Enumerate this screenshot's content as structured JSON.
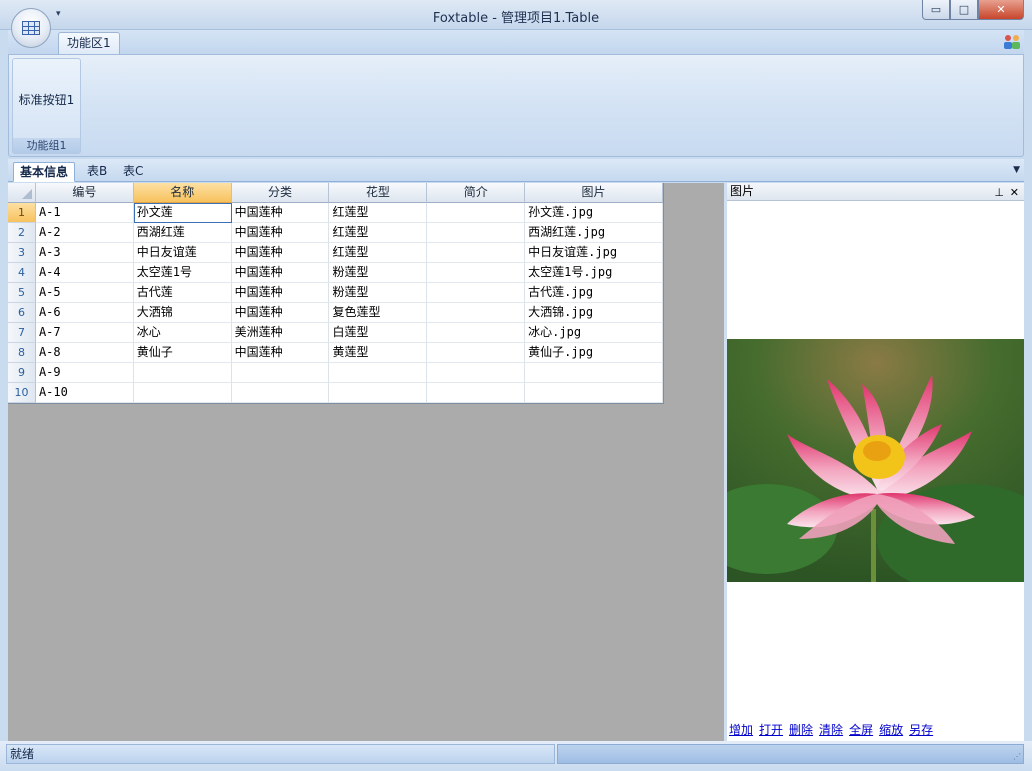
{
  "window": {
    "title": "Foxtable - 管理项目1.Table",
    "min_glyph": "▭",
    "max_glyph": "□",
    "close_glyph": "✕",
    "qat_glyph": "▾"
  },
  "ribbon": {
    "tab_label": "功能区1",
    "group_label": "功能组1",
    "button_label": "标准按钮1"
  },
  "doc_tabs": [
    "基本信息",
    "表B",
    "表C"
  ],
  "doc_tab_arrow": "▼",
  "table": {
    "columns": [
      "编号",
      "名称",
      "分类",
      "花型",
      "简介",
      "图片"
    ],
    "rows": [
      [
        "1",
        "A-1",
        "孙文莲",
        "中国莲种",
        "红莲型",
        "",
        "孙文莲.jpg"
      ],
      [
        "2",
        "A-2",
        "西湖红莲",
        "中国莲种",
        "红莲型",
        "",
        "西湖红莲.jpg"
      ],
      [
        "3",
        "A-3",
        "中日友谊莲",
        "中国莲种",
        "红莲型",
        "",
        "中日友谊莲.jpg"
      ],
      [
        "4",
        "A-4",
        "太空莲1号",
        "中国莲种",
        "粉莲型",
        "",
        "太空莲1号.jpg"
      ],
      [
        "5",
        "A-5",
        "古代莲",
        "中国莲种",
        "粉莲型",
        "",
        "古代莲.jpg"
      ],
      [
        "6",
        "A-6",
        "大洒锦",
        "中国莲种",
        "复色莲型",
        "",
        "大洒锦.jpg"
      ],
      [
        "7",
        "A-7",
        "冰心",
        "美洲莲种",
        "白莲型",
        "",
        "冰心.jpg"
      ],
      [
        "8",
        "A-8",
        "黄仙子",
        "中国莲种",
        "黄莲型",
        "",
        "黄仙子.jpg"
      ],
      [
        "9",
        "A-9",
        "",
        "",
        "",
        "",
        ""
      ],
      [
        "10",
        "A-10",
        "",
        "",
        "",
        "",
        ""
      ]
    ]
  },
  "picture_panel": {
    "title": "图片",
    "pin_glyph": "⊥",
    "close_glyph": "✕",
    "links": [
      "增加",
      "打开",
      "删除",
      "清除",
      "全屏",
      "缩放",
      "另存"
    ]
  },
  "status": {
    "text": "就绪",
    "grip_glyph": "⋰"
  },
  "colors": {
    "accent": "#f7c25e",
    "ribbon": "#c7daf0",
    "grid_background": "#ababab",
    "link": "#0000cc"
  }
}
